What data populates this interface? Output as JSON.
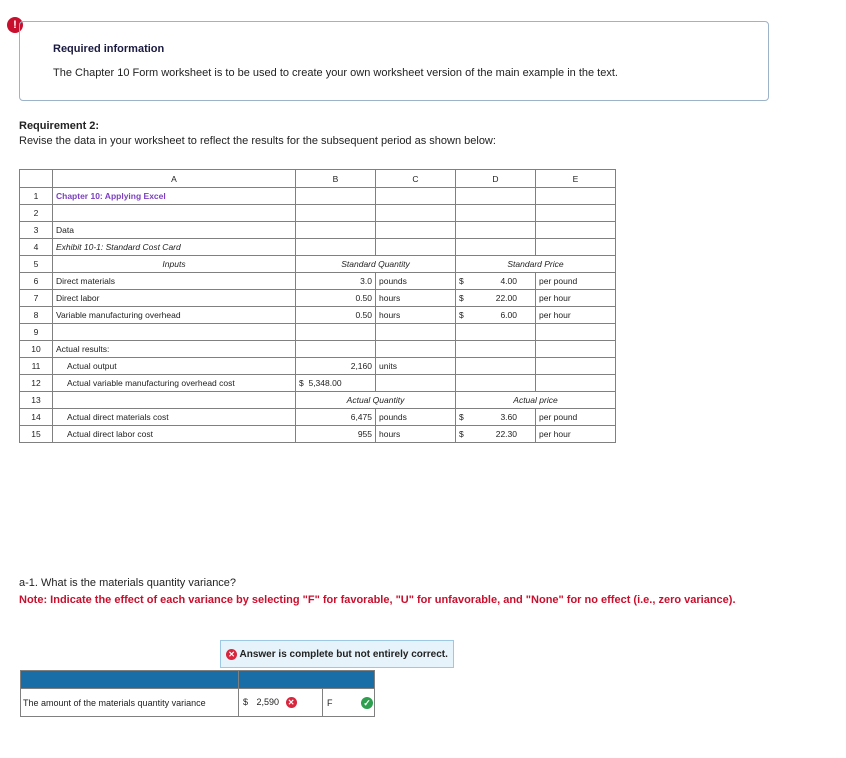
{
  "alert": {
    "icon": "exclamation-icon",
    "symbol": "!"
  },
  "info": {
    "title": "Required information",
    "text": "The Chapter 10 Form worksheet is to be used to create your own worksheet version of the main example in the text."
  },
  "requirement": {
    "title": "Requirement 2:",
    "text": "Revise the data in your worksheet to reflect the results for the subsequent period as shown below:"
  },
  "sheet": {
    "columns": [
      "A",
      "B",
      "C",
      "D",
      "E"
    ],
    "rows": [
      {
        "n": "1",
        "a": "Chapter 10: Applying Excel",
        "b": "",
        "c": "",
        "d1": "",
        "d2": "",
        "e": ""
      },
      {
        "n": "2",
        "a": "",
        "b": "",
        "c": "",
        "d1": "",
        "d2": "",
        "e": ""
      },
      {
        "n": "3",
        "a": "Data",
        "b": "",
        "c": "",
        "d1": "",
        "d2": "",
        "e": ""
      },
      {
        "n": "4",
        "a": "Exhibit 10-1: Standard Cost Card",
        "b": "",
        "c": "",
        "d1": "",
        "d2": "",
        "e": ""
      },
      {
        "n": "5",
        "a": "Inputs",
        "bc": "Standard Quantity",
        "de": "Standard Price"
      },
      {
        "n": "6",
        "a": "Direct materials",
        "b": "3.0",
        "c": "pounds",
        "d1": "$",
        "d2": "4.00",
        "e": "per pound"
      },
      {
        "n": "7",
        "a": "Direct labor",
        "b": "0.50",
        "c": "hours",
        "d1": "$",
        "d2": "22.00",
        "e": "per hour"
      },
      {
        "n": "8",
        "a": "Variable manufacturing overhead",
        "b": "0.50",
        "c": "hours",
        "d1": "$",
        "d2": "6.00",
        "e": "per hour"
      },
      {
        "n": "9",
        "a": "",
        "b": "",
        "c": "",
        "d1": "",
        "d2": "",
        "e": ""
      },
      {
        "n": "10",
        "a": "Actual results:",
        "b": "",
        "c": "",
        "d1": "",
        "d2": "",
        "e": ""
      },
      {
        "n": "11",
        "a": "Actual output",
        "b": "2,160",
        "c": "units",
        "d1": "",
        "d2": "",
        "e": ""
      },
      {
        "n": "12",
        "a": "Actual variable manufacturing overhead cost",
        "b_dollar": "$",
        "b": "5,348.00",
        "c": "",
        "d1": "",
        "d2": "",
        "e": ""
      },
      {
        "n": "13",
        "a": "",
        "bc": "Actual Quantity",
        "de": "Actual price"
      },
      {
        "n": "14",
        "a": "Actual direct materials cost",
        "b": "6,475",
        "c": "pounds",
        "d1": "$",
        "d2": "3.60",
        "e": "per pound"
      },
      {
        "n": "15",
        "a": "Actual direct labor cost",
        "b": "955",
        "c": "hours",
        "d1": "$",
        "d2": "22.30",
        "e": "per hour"
      }
    ]
  },
  "question": {
    "text": "a-1. What is the materials quantity variance?",
    "note": "Note: Indicate the effect of each variance by selecting \"F\" for favorable, \"U\" for unfavorable, and \"None\" for no effect (i.e., zero variance)."
  },
  "answer": {
    "banner": "Answer is complete but not entirely correct.",
    "label": "The amount of the materials quantity variance",
    "currency": "$",
    "value": "2,590",
    "effect": "F"
  },
  "colors": {
    "accent": "#1a6ea8",
    "error": "#d7263d",
    "correct": "#2e9e4f",
    "heading_purple": "#7b3fbf"
  }
}
